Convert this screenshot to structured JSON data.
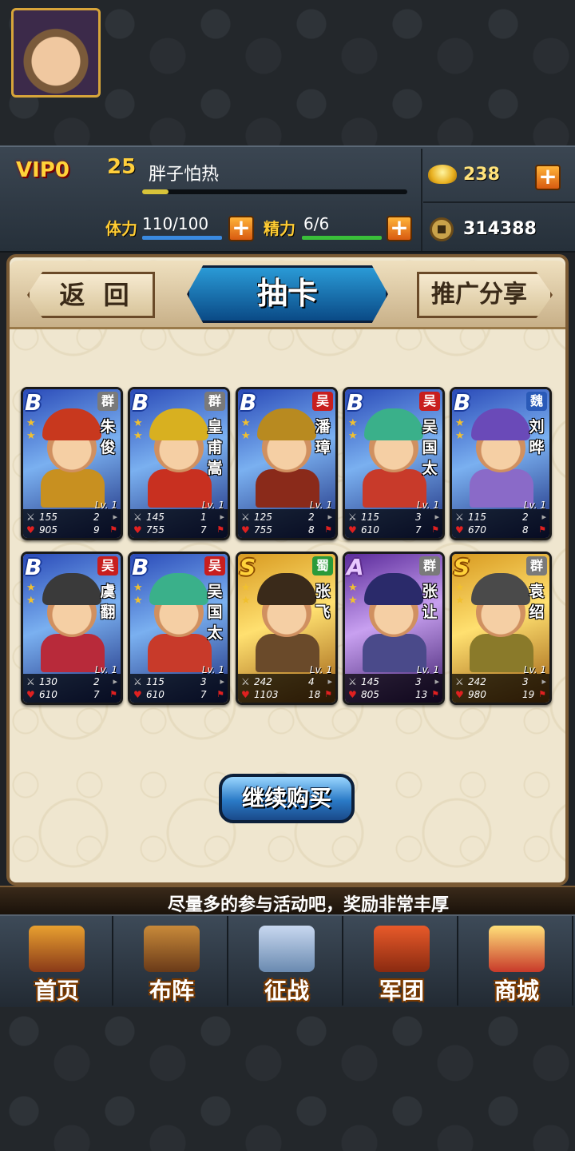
{
  "player": {
    "vip": "VIP0",
    "level": "25",
    "name": "胖子怕热",
    "exp_fraction": 0.1,
    "stamina_label": "体力",
    "stamina_value": "110/100",
    "spirit_label": "精力",
    "spirit_value": "6/6",
    "gold": "238",
    "coins": "314388"
  },
  "tabs": {
    "back": "返 回",
    "active": "抽卡",
    "share": "推广分享"
  },
  "cards": [
    {
      "rank": "B",
      "faction": "群",
      "name": "朱俊",
      "level": "Lv. 1",
      "attack": "155",
      "hp": "905",
      "atk_count": "2",
      "hp_count": "9"
    },
    {
      "rank": "B",
      "faction": "群",
      "name": "皇甫嵩",
      "level": "Lv. 1",
      "attack": "145",
      "hp": "755",
      "atk_count": "1",
      "hp_count": "7"
    },
    {
      "rank": "B",
      "faction": "吴",
      "name": "潘璋",
      "level": "Lv. 1",
      "attack": "125",
      "hp": "755",
      "atk_count": "2",
      "hp_count": "8"
    },
    {
      "rank": "B",
      "faction": "吴",
      "name": "吴国太",
      "level": "Lv. 1",
      "attack": "115",
      "hp": "610",
      "atk_count": "3",
      "hp_count": "7"
    },
    {
      "rank": "B",
      "faction": "魏",
      "name": "刘晔",
      "level": "Lv. 1",
      "attack": "115",
      "hp": "670",
      "atk_count": "2",
      "hp_count": "8"
    },
    {
      "rank": "B",
      "faction": "吴",
      "name": "虞翻",
      "level": "Lv. 1",
      "attack": "130",
      "hp": "610",
      "atk_count": "2",
      "hp_count": "7"
    },
    {
      "rank": "B",
      "faction": "吴",
      "name": "吴国太",
      "level": "Lv. 1",
      "attack": "115",
      "hp": "610",
      "atk_count": "3",
      "hp_count": "7"
    },
    {
      "rank": "S",
      "faction": "蜀",
      "name": "张飞",
      "level": "Lv. 1",
      "attack": "242",
      "hp": "1103",
      "atk_count": "4",
      "hp_count": "18"
    },
    {
      "rank": "A",
      "faction": "群",
      "name": "张让",
      "level": "Lv. 1",
      "attack": "145",
      "hp": "805",
      "atk_count": "3",
      "hp_count": "13"
    },
    {
      "rank": "S",
      "faction": "群",
      "name": "袁绍",
      "level": "Lv. 1",
      "attack": "242",
      "hp": "980",
      "atk_count": "3",
      "hp_count": "19"
    }
  ],
  "continue_button": "继续购买",
  "ticker": "尽量多的参与活动吧，奖励非常丰厚",
  "nav": [
    {
      "label": "首页",
      "icon": "palace-icon"
    },
    {
      "label": "布阵",
      "icon": "chess-pieces-icon"
    },
    {
      "label": "征战",
      "icon": "crossed-swords-icon"
    },
    {
      "label": "军团",
      "icon": "war-banner-icon"
    },
    {
      "label": "商城",
      "icon": "treasure-bag-icon"
    }
  ],
  "colors": {
    "faction_qun": "#7a7a7a",
    "faction_wu": "#c81e1e",
    "faction_wei": "#2a5ab8",
    "faction_shu": "#2a9a3a",
    "accent_gold": "#ffcc33"
  }
}
